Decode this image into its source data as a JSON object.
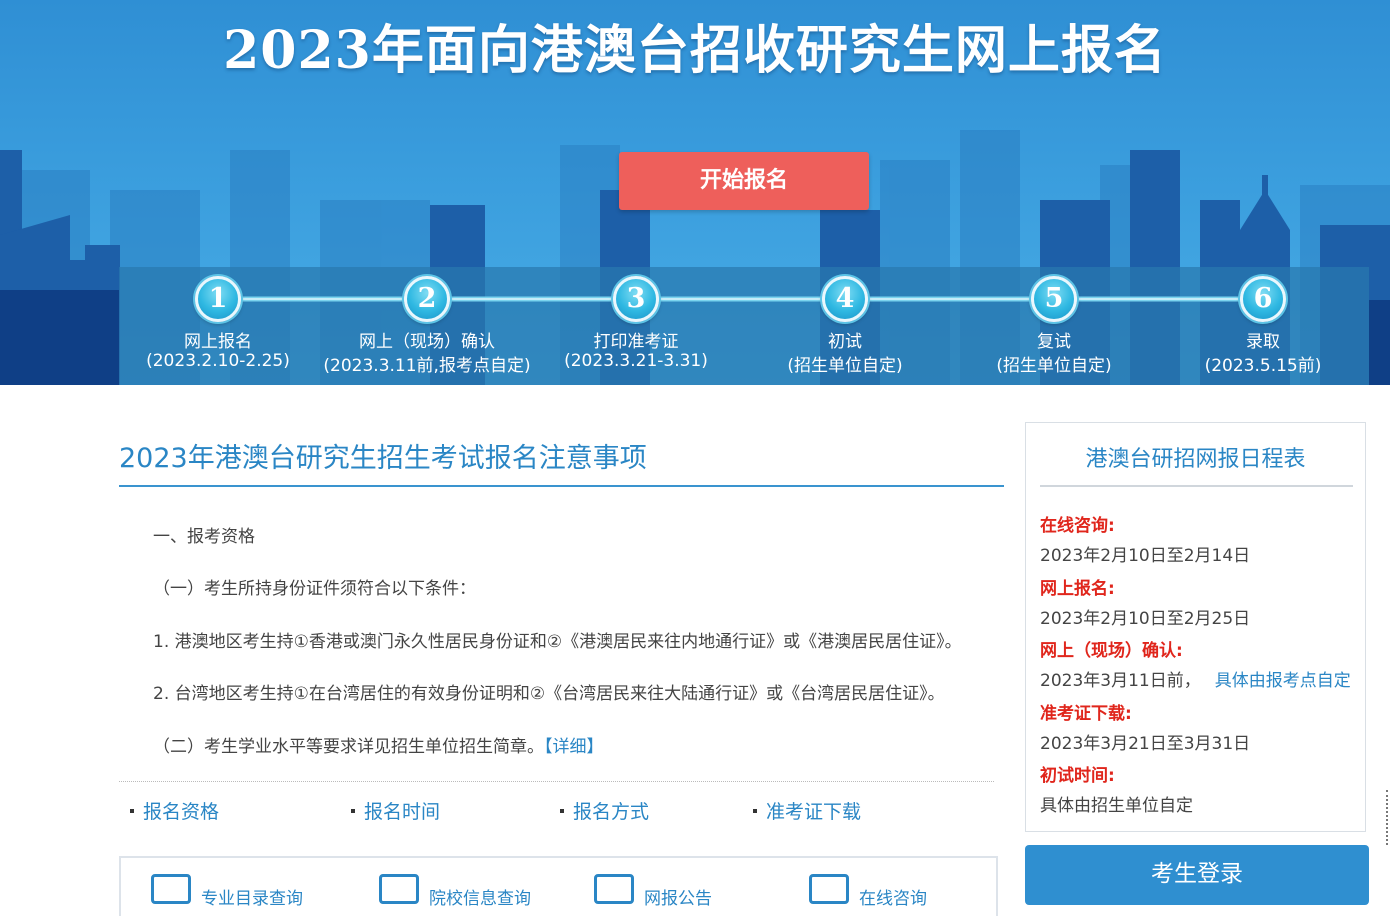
{
  "banner": {
    "title": "2023年面向港澳台招收研究生网上报名",
    "start_button": "开始报名"
  },
  "steps": [
    {
      "num": "1",
      "name": "网上报名",
      "date": "(2023.2.10-2.25)"
    },
    {
      "num": "2",
      "name": "网上（现场）确认",
      "date": "(2023.3.11前,报考点自定)"
    },
    {
      "num": "3",
      "name": "打印准考证",
      "date": "(2023.3.21-3.31)"
    },
    {
      "num": "4",
      "name": "初试",
      "date": "(招生单位自定)"
    },
    {
      "num": "5",
      "name": "复试",
      "date": "(招生单位自定)"
    },
    {
      "num": "6",
      "name": "录取",
      "date": "(2023.5.15前)"
    }
  ],
  "notice": {
    "title": "2023年港澳台研究生招生考试报名注意事项",
    "p1": "一、报考资格",
    "p2": "（一）考生所持身份证件须符合以下条件：",
    "p3": "1. 港澳地区考生持①香港或澳门永久性居民身份证和②《港澳居民来往内地通行证》或《港澳居民居住证》。",
    "p4": "2. 台湾地区考生持①在台湾居住的有效身份证明和②《台湾居民来往大陆通行证》或《台湾居民居住证》。",
    "p5": "（二）考生学业水平等要求详见招生单位招生简章。",
    "detail_link": "【详细】"
  },
  "quick_links": [
    "报名资格",
    "报名时间",
    "报名方式",
    "准考证下载"
  ],
  "services": [
    "专业目录查询",
    "院校信息查询",
    "网报公告",
    "在线咨询"
  ],
  "schedule": {
    "title": "港澳台研招网报日程表",
    "items": [
      {
        "label": "在线咨询:",
        "value": "2023年2月10日至2月14日",
        "extra": ""
      },
      {
        "label": "网上报名:",
        "value": "2023年2月10日至2月25日",
        "extra": ""
      },
      {
        "label": "网上（现场）确认:",
        "value": "2023年3月11日前，",
        "extra": "具体由报考点自定"
      },
      {
        "label": "准考证下载:",
        "value": "2023年3月21日至3月31日",
        "extra": ""
      },
      {
        "label": "初试时间:",
        "value": "具体由招生单位自定",
        "extra": ""
      }
    ]
  },
  "login_button": "考生登录",
  "colors": {
    "accent": "#2a86c5",
    "banner": "#3a9ddd",
    "start": "#ee5f5b",
    "label_red": "#e0261c"
  }
}
